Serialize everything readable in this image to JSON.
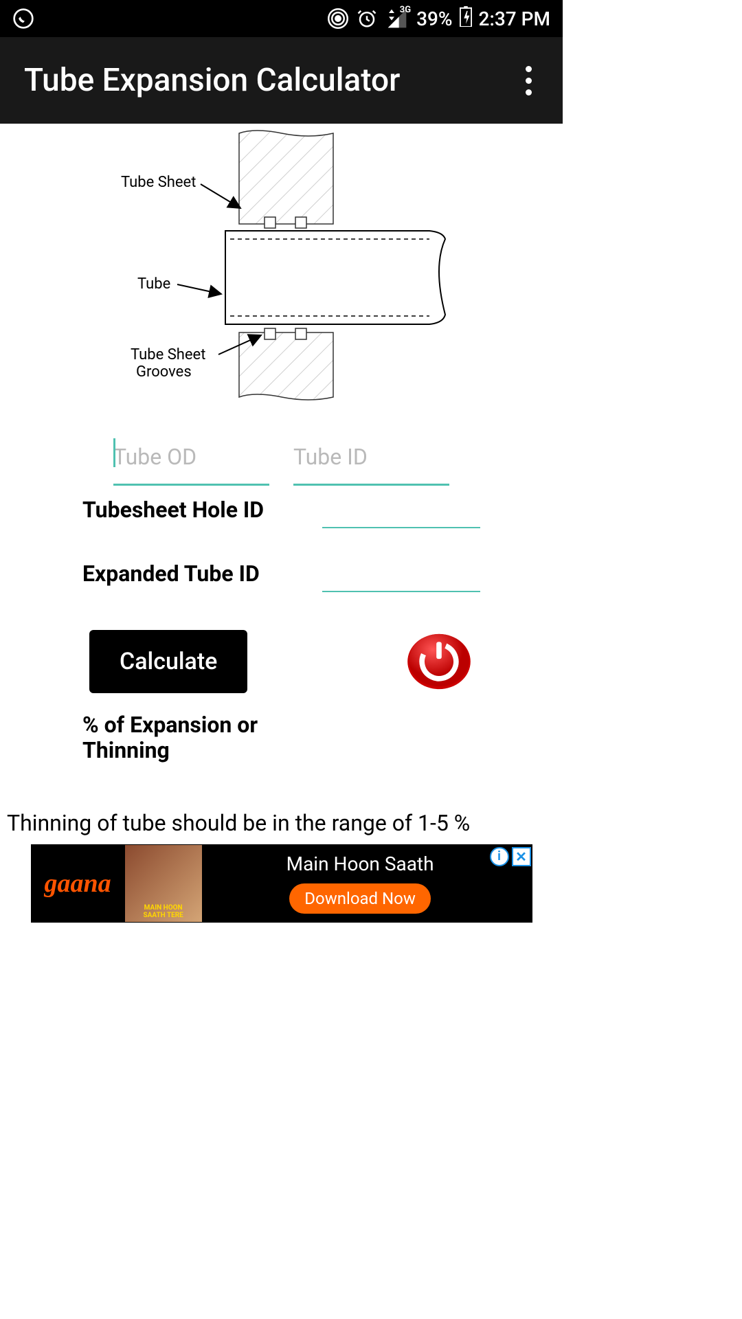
{
  "status_bar": {
    "battery": "39%",
    "time": "2:37 PM",
    "network_type": "3G"
  },
  "header": {
    "title": "Tube Expansion Calculator"
  },
  "diagram": {
    "label_tube_sheet": "Tube Sheet",
    "label_tube": "Tube",
    "label_grooves_l1": "Tube Sheet",
    "label_grooves_l2": "Grooves"
  },
  "inputs": {
    "tube_od_placeholder": "Tube OD",
    "tube_id_placeholder": "Tube ID"
  },
  "labels": {
    "tubesheet_hole": "Tubesheet Hole ID",
    "expanded_tube": "Expanded Tube ID",
    "expansion_pct": "% of Expansion or Thinning"
  },
  "buttons": {
    "calculate": "Calculate"
  },
  "note": "Thinning of tube should be in the range of 1-5 %",
  "ad": {
    "brand": "gaana",
    "album_l1": "MAIN HOON",
    "album_l2": "SAATH TERE",
    "title": "Main Hoon Saath",
    "cta": "Download Now"
  }
}
